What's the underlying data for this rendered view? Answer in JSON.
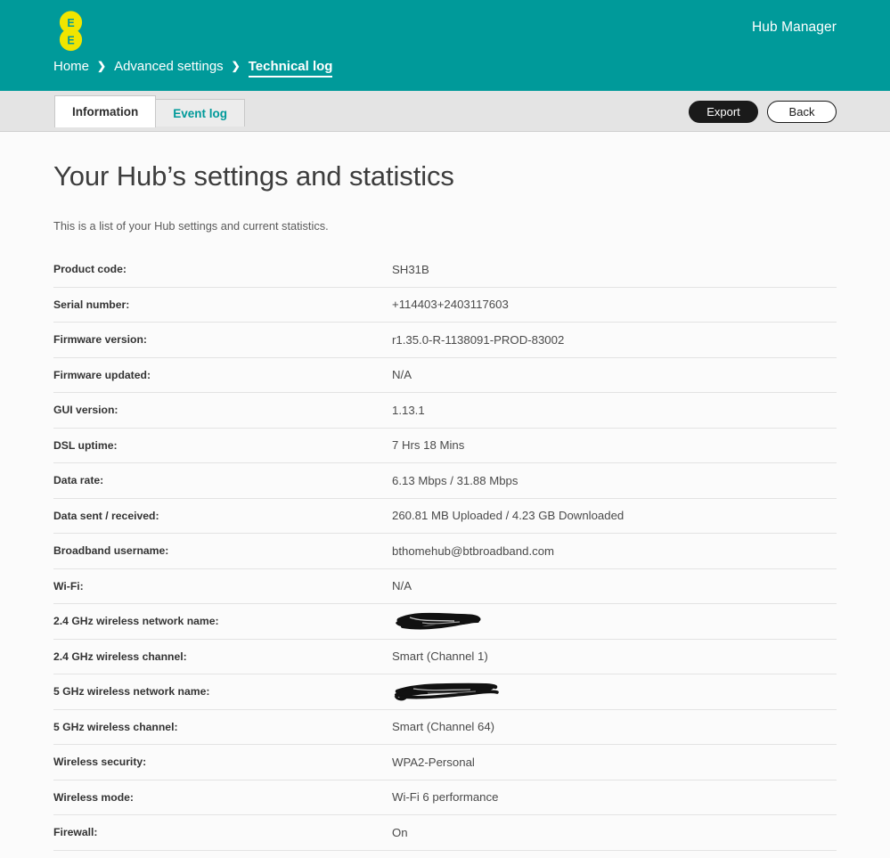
{
  "brand": {
    "logo_name": "ee-logo",
    "teal": "#009a9a",
    "yellow": "#f0e500",
    "logo_letter": "E"
  },
  "header": {
    "app_title": "Hub Manager",
    "breadcrumb": [
      {
        "label": "Home",
        "current": false
      },
      {
        "label": "Advanced settings",
        "current": false
      },
      {
        "label": "Technical log",
        "current": true
      }
    ],
    "breadcrumb_separator": "❯"
  },
  "toolbar": {
    "tabs": [
      {
        "label": "Information",
        "active": true
      },
      {
        "label": "Event log",
        "active": false
      }
    ],
    "export_label": "Export",
    "back_label": "Back"
  },
  "main": {
    "title": "Your Hub’s settings and statistics",
    "intro": "This is a list of your Hub settings and current statistics.",
    "rows": [
      {
        "label": "Product code:",
        "value": "SH31B",
        "redacted": false
      },
      {
        "label": "Serial number:",
        "value": "+114403+2403117603",
        "redacted": false
      },
      {
        "label": "Firmware version:",
        "value": "r1.35.0-R-1138091-PROD-83002",
        "redacted": false
      },
      {
        "label": "Firmware updated:",
        "value": "N/A",
        "redacted": false
      },
      {
        "label": "GUI version:",
        "value": "1.13.1",
        "redacted": false
      },
      {
        "label": "DSL uptime:",
        "value": "7 Hrs 18 Mins",
        "redacted": false
      },
      {
        "label": "Data rate:",
        "value": "6.13 Mbps / 31.88 Mbps",
        "redacted": false
      },
      {
        "label": "Data sent / received:",
        "value": "260.81 MB Uploaded / 4.23 GB Downloaded",
        "redacted": false
      },
      {
        "label": "Broadband username:",
        "value": "bthomehub@btbroadband.com",
        "redacted": false
      },
      {
        "label": "Wi-Fi:",
        "value": "N/A",
        "redacted": false
      },
      {
        "label": "2.4 GHz wireless network name:",
        "value": "",
        "redacted": true,
        "redaction_style": "blob"
      },
      {
        "label": "2.4 GHz wireless channel:",
        "value": "Smart (Channel 1)",
        "redacted": false
      },
      {
        "label": "5 GHz wireless network name:",
        "value": "",
        "redacted": true,
        "redaction_style": "streak"
      },
      {
        "label": "5 GHz wireless channel:",
        "value": "Smart (Channel 64)",
        "redacted": false
      },
      {
        "label": "Wireless security:",
        "value": "WPA2-Personal",
        "redacted": false
      },
      {
        "label": "Wireless mode:",
        "value": "Wi-Fi 6 performance",
        "redacted": false
      },
      {
        "label": "Firewall:",
        "value": "On",
        "redacted": false
      }
    ]
  }
}
